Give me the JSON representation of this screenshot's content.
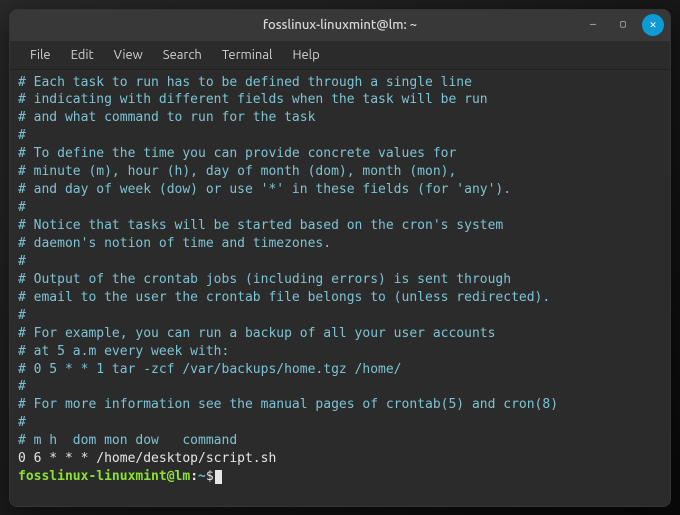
{
  "window": {
    "title": "fosslinux-linuxmint@lm: ~"
  },
  "menubar": {
    "items": [
      "File",
      "Edit",
      "View",
      "Search",
      "Terminal",
      "Help"
    ]
  },
  "terminal": {
    "lines": [
      {
        "type": "comment",
        "text": "# Each task to run has to be defined through a single line"
      },
      {
        "type": "comment",
        "text": "# indicating with different fields when the task will be run"
      },
      {
        "type": "comment",
        "text": "# and what command to run for the task"
      },
      {
        "type": "comment",
        "text": "#"
      },
      {
        "type": "comment",
        "text": "# To define the time you can provide concrete values for"
      },
      {
        "type": "comment",
        "text": "# minute (m), hour (h), day of month (dom), month (mon),"
      },
      {
        "type": "comment",
        "text": "# and day of week (dow) or use '*' in these fields (for 'any')."
      },
      {
        "type": "comment",
        "text": "#"
      },
      {
        "type": "comment",
        "text": "# Notice that tasks will be started based on the cron's system"
      },
      {
        "type": "comment",
        "text": "# daemon's notion of time and timezones."
      },
      {
        "type": "comment",
        "text": "#"
      },
      {
        "type": "comment",
        "text": "# Output of the crontab jobs (including errors) is sent through"
      },
      {
        "type": "comment",
        "text": "# email to the user the crontab file belongs to (unless redirected)."
      },
      {
        "type": "comment",
        "text": "#"
      },
      {
        "type": "comment",
        "text": "# For example, you can run a backup of all your user accounts"
      },
      {
        "type": "comment",
        "text": "# at 5 a.m every week with:"
      },
      {
        "type": "comment",
        "text": "# 0 5 * * 1 tar -zcf /var/backups/home.tgz /home/"
      },
      {
        "type": "comment",
        "text": "#"
      },
      {
        "type": "comment",
        "text": "# For more information see the manual pages of crontab(5) and cron(8)"
      },
      {
        "type": "comment",
        "text": "#"
      },
      {
        "type": "comment",
        "text": "# m h  dom mon dow   command"
      },
      {
        "type": "plain",
        "text": ""
      },
      {
        "type": "plain",
        "text": "0 6 * * * /home/desktop/script.sh"
      }
    ],
    "prompt": {
      "user_host": "fosslinux-linuxmint@lm",
      "separator": ":",
      "path": "~",
      "symbol": "$"
    }
  },
  "controls": {
    "minimize_glyph": "–",
    "maximize_glyph": "▢",
    "close_glyph": "✕"
  }
}
